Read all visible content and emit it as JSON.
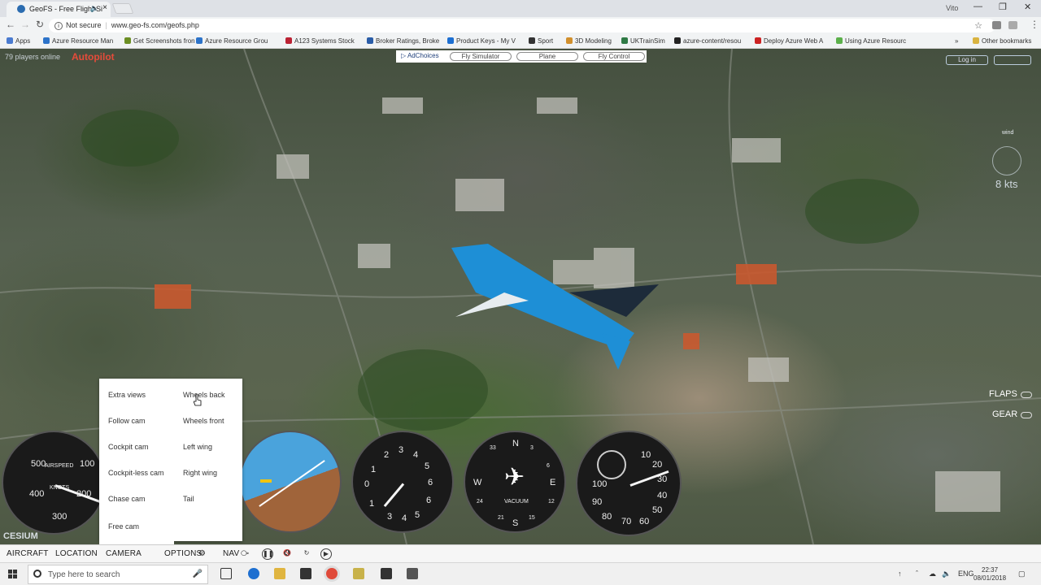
{
  "browser": {
    "tab_title": "GeoFS - Free Flight Si",
    "user": "Vito",
    "security": "Not secure",
    "url": "www.geo-fs.com/geofs.php",
    "bookmarks": [
      {
        "label": "Apps",
        "color": "#4a7bd0"
      },
      {
        "label": "Azure Resource Man",
        "color": "#2c73c9"
      },
      {
        "label": "Get Screenshots fron",
        "color": "#6b8e23"
      },
      {
        "label": "Azure Resource Grou",
        "color": "#2c73c9"
      },
      {
        "label": "A123 Systems Stock",
        "color": "#b23"
      },
      {
        "label": "Broker Ratings, Broke",
        "color": "#2a5da8"
      },
      {
        "label": "Product Keys - My V",
        "color": "#1d6fd2"
      },
      {
        "label": "Sport",
        "color": "#333"
      },
      {
        "label": "3D Modeling",
        "color": "#d18f2c"
      },
      {
        "label": "UKTrainSim",
        "color": "#2f7a45"
      },
      {
        "label": "azure-content/resou",
        "color": "#222"
      },
      {
        "label": "Deploy Azure Web A",
        "color": "#c22"
      },
      {
        "label": "Using Azure Resourc",
        "color": "#5bb04a"
      }
    ],
    "other_bookmarks": "Other bookmarks"
  },
  "sim": {
    "players_online": "79 players online",
    "autopilot": "Autopilot",
    "top_menu": {
      "adchoices": "AdChoices",
      "fly_simulator": "Fly Simulator",
      "plane": "Plane",
      "fly_control": "Fly Control"
    },
    "login": "Log in",
    "wind_label": "wind",
    "wind_speed": "8 kts",
    "flaps": "FLAPS",
    "gear": "GEAR"
  },
  "camera_menu": {
    "left": [
      "Extra views",
      "Follow cam",
      "Cockpit cam",
      "Cockpit-less cam",
      "Chase cam",
      "Free cam"
    ],
    "right": [
      "Wheels back",
      "Wheels front",
      "Left wing",
      "Right wing",
      "Tail"
    ]
  },
  "instruments": {
    "airspeed": {
      "title": "AIRSPEED",
      "unit": "KNOTS",
      "marks": [
        "500",
        "100",
        "400",
        "200",
        "300"
      ]
    },
    "altimeter": {
      "marks": [
        "2",
        "3",
        "4",
        "5",
        "1",
        "6",
        "0",
        "6",
        "1",
        "3",
        "4",
        "5"
      ]
    },
    "heading": {
      "label": "VACUUM",
      "marks": [
        "N",
        "3",
        "33",
        "6",
        "W",
        "E",
        "24",
        "12",
        "21",
        "S",
        "15"
      ]
    },
    "vsi": {
      "marks": [
        "10",
        "20",
        "30",
        "40",
        "50",
        "60",
        "70",
        "80",
        "90",
        "100"
      ]
    }
  },
  "attribution": "CESIUM",
  "bottom_bar": {
    "aircraft": "AIRCRAFT",
    "location": "LOCATION",
    "camera": "CAMERA",
    "options": "OPTIONS",
    "nav": "NAV"
  },
  "taskbar": {
    "search_placeholder": "Type here to search",
    "lang": "ENG",
    "time": "22:37",
    "date": "08/01/2018"
  }
}
